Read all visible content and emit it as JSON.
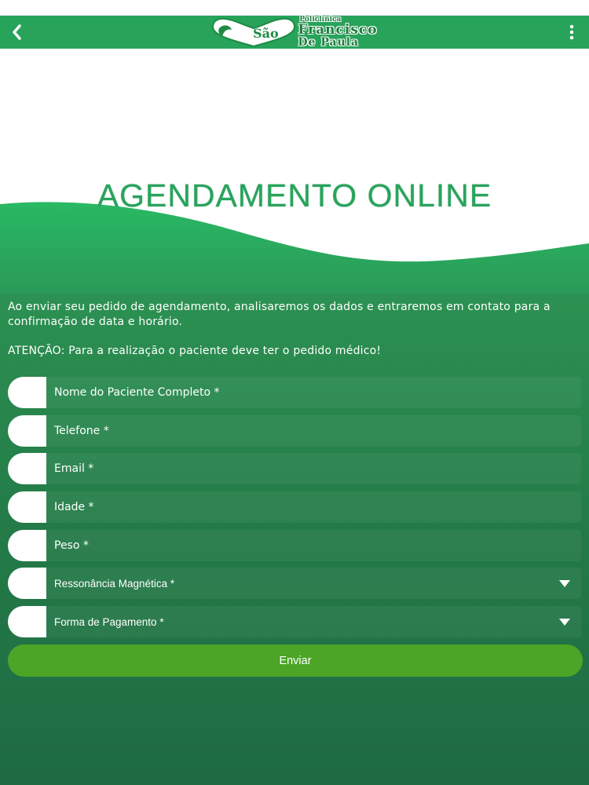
{
  "header": {
    "back_icon": "chevron-left-icon",
    "menu_icon": "more-vertical-icon",
    "logo": {
      "line1": "Policlínica",
      "sao": "São",
      "line2": "Francisco",
      "line3": "De Paula"
    }
  },
  "banner": {
    "title": "AGENDAMENTO ONLINE"
  },
  "intro": {
    "description": "Ao enviar seu pedido de agendamento, analisaremos os dados e entraremos em contato para a confirmação de data e horário.",
    "attention": "ATENÇÃO: Para a realização o paciente deve ter o pedido médico!"
  },
  "form": {
    "fields": [
      {
        "placeholder": "Nome do Paciente Completo *"
      },
      {
        "placeholder": "Telefone *"
      },
      {
        "placeholder": "Email *"
      },
      {
        "placeholder": "Idade *"
      },
      {
        "placeholder": "Peso *"
      }
    ],
    "selects": [
      {
        "label": "Ressonância Magnética *"
      },
      {
        "label": "Forma de Pagamento *"
      }
    ],
    "submit_label": "Enviar"
  },
  "colors": {
    "top_bar": "#27a35a",
    "banner_title": "#2aa35d",
    "content_bg": "#237a47",
    "submit_button": "#4ca526"
  }
}
